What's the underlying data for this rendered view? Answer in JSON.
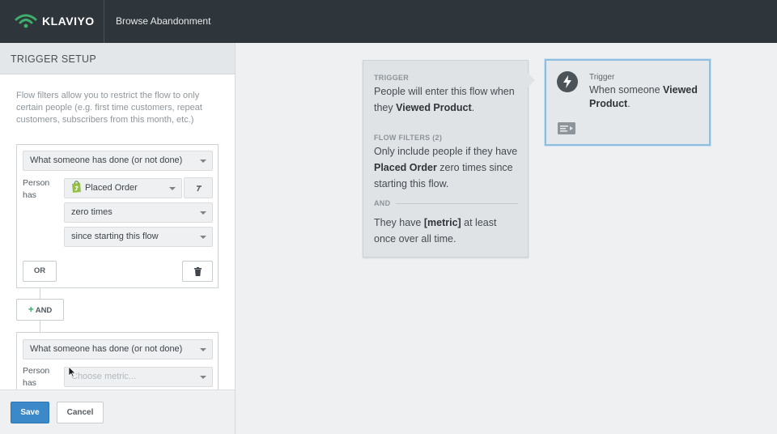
{
  "app": {
    "brand": "KLAVIYO",
    "flow_name": "Browse Abandonment"
  },
  "panel": {
    "title": "TRIGGER SETUP",
    "help_text": "Flow filters allow you to restrict the flow to only certain people (e.g. first time customers, repeat customers, subscribers from this month, etc.)",
    "filter1": {
      "condition_type": "What someone has done (or not done)",
      "person_has_label": "Person has",
      "metric": "Placed Order",
      "frequency": "zero times",
      "timeframe": "since starting this flow",
      "or_label": "OR"
    },
    "and_label": "AND",
    "filter2": {
      "condition_type": "What someone has done (or not done)",
      "person_has_label": "Person has",
      "metric_placeholder": "Choose metric..."
    },
    "save_label": "Save",
    "cancel_label": "Cancel"
  },
  "summary": {
    "trigger_label": "TRIGGER",
    "trigger_text_1": "People will enter this flow when they ",
    "trigger_text_bold": "Viewed Product",
    "trigger_text_2": ".",
    "filters_label": "FLOW FILTERS (2)",
    "filter_text_1": "Only include people if they have ",
    "filter_text_bold": "Placed Order",
    "filter_text_2": " zero times since starting this flow.",
    "and_label": "AND",
    "filter2_text_1": "They have ",
    "filter2_text_bold": "[metric]",
    "filter2_text_2": " at least once over all time."
  },
  "trigger_node": {
    "label": "Trigger",
    "text_1": "When someone ",
    "text_bold": "Viewed Product",
    "text_2": "."
  },
  "colors": {
    "topbar": "#2e353b",
    "primary_button": "#3b89c8",
    "brand_green": "#3fae6a",
    "selected_border": "#8fbde0"
  },
  "icons": {
    "trigger_icon": "lightning-bolt-icon",
    "node_footer_icon": "card-icon",
    "delete_icon": "trash-icon",
    "shopify_icon": "shopify-bag-icon"
  }
}
